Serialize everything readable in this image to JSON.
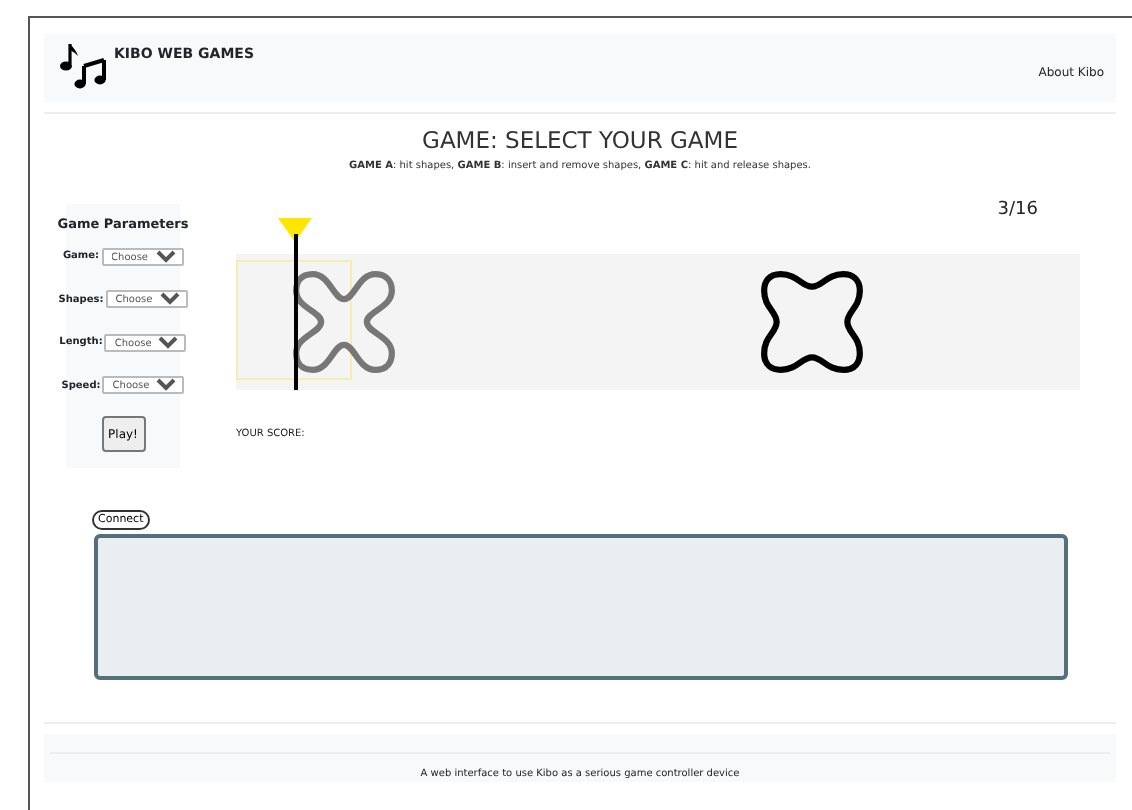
{
  "navbar": {
    "brand": "KIBO WEB GAMES",
    "links": [
      "About Kibo"
    ]
  },
  "heading": {
    "title": "GAME: SELECT YOUR GAME",
    "subtitle": "**GAME A**: hit shapes, **GAME B**: insert and remove shapes, **GAME C**: hit and release shapes."
  },
  "parameters": {
    "title": "Game Parameters",
    "fields": [
      {
        "label": "Game:",
        "value": "Choose"
      },
      {
        "label": "Shapes:",
        "value": "Choose"
      },
      {
        "label": "Length:",
        "value": "Choose"
      },
      {
        "label": "Speed:",
        "value": "Choose"
      }
    ],
    "play_button": "Play!"
  },
  "stage": {
    "counter": "3/16",
    "score_label": "YOUR SCORE:",
    "shapes": [
      {
        "kind": "cross",
        "dimmed": true
      },
      {
        "kind": "flower",
        "dimmed": false
      }
    ]
  },
  "connect_button": "Connect",
  "footer": {
    "text": "A web interface to use Kibo as a serious game controller device"
  }
}
